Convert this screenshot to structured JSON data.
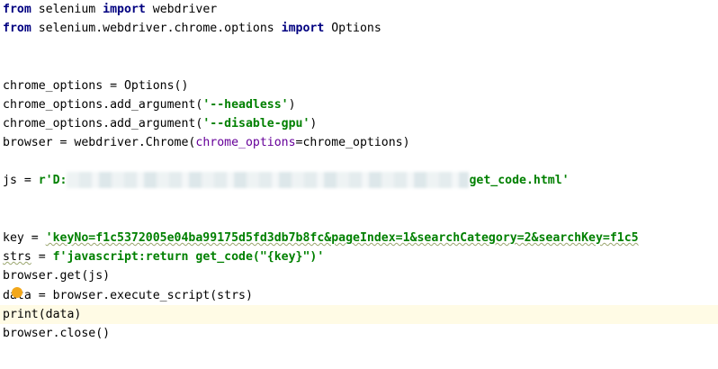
{
  "editor": {
    "lines": {
      "l1": {
        "kw1": "from",
        "mid": " selenium ",
        "kw2": "import",
        "rest": " webdriver"
      },
      "l2": {
        "kw1": "from",
        "mid": " selenium.webdriver.chrome.options ",
        "kw2": "import",
        "rest": " Options"
      },
      "l5": "chrome_options = Options()",
      "l6": {
        "pre": "chrome_options.add_argument(",
        "str": "'--headless'",
        "post": ")"
      },
      "l7": {
        "pre": "chrome_options.add_argument(",
        "str": "'--disable-gpu'",
        "post": ")"
      },
      "l8": {
        "pre": "browser = webdriver.Chrome(",
        "param": "chrome_options",
        "post": "=chrome_options)"
      },
      "l10": {
        "pre": "js = ",
        "str1": "r'D:",
        "str2": "get_code.html'"
      },
      "l13": {
        "pre": "key = ",
        "str": "'keyNo=f1c5372005e04ba99175d5fd3db7b8fc&pageIndex=1&searchCategory=2&searchKey=f1c5"
      },
      "l14": {
        "var": "strs",
        "pre": " = ",
        "str": "f'javascript:return get_code(\"{key}\")'"
      },
      "l15": "browser.get(js)",
      "l16": "data = browser.execute_script(strs)",
      "l17": "print(data)",
      "l18": "browser.close()"
    }
  }
}
